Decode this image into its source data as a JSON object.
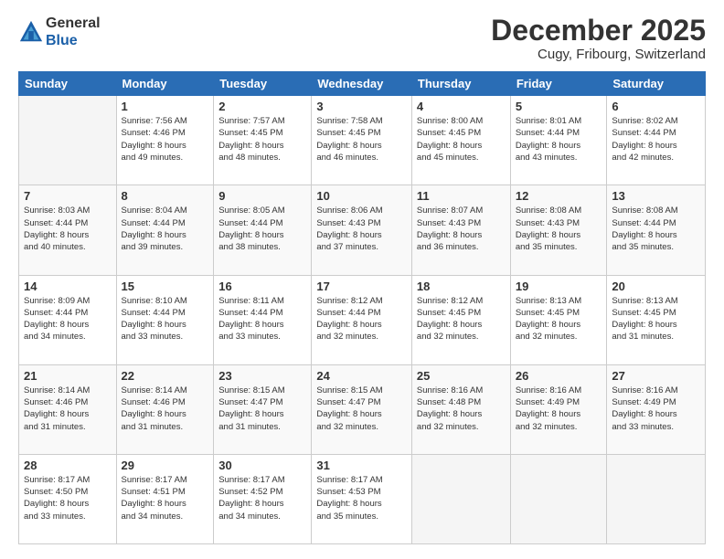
{
  "header": {
    "logo_line1": "General",
    "logo_line2": "Blue",
    "month": "December 2025",
    "location": "Cugy, Fribourg, Switzerland"
  },
  "weekdays": [
    "Sunday",
    "Monday",
    "Tuesday",
    "Wednesday",
    "Thursday",
    "Friday",
    "Saturday"
  ],
  "weeks": [
    [
      {
        "day": "",
        "info": ""
      },
      {
        "day": "1",
        "info": "Sunrise: 7:56 AM\nSunset: 4:46 PM\nDaylight: 8 hours\nand 49 minutes."
      },
      {
        "day": "2",
        "info": "Sunrise: 7:57 AM\nSunset: 4:45 PM\nDaylight: 8 hours\nand 48 minutes."
      },
      {
        "day": "3",
        "info": "Sunrise: 7:58 AM\nSunset: 4:45 PM\nDaylight: 8 hours\nand 46 minutes."
      },
      {
        "day": "4",
        "info": "Sunrise: 8:00 AM\nSunset: 4:45 PM\nDaylight: 8 hours\nand 45 minutes."
      },
      {
        "day": "5",
        "info": "Sunrise: 8:01 AM\nSunset: 4:44 PM\nDaylight: 8 hours\nand 43 minutes."
      },
      {
        "day": "6",
        "info": "Sunrise: 8:02 AM\nSunset: 4:44 PM\nDaylight: 8 hours\nand 42 minutes."
      }
    ],
    [
      {
        "day": "7",
        "info": "Sunrise: 8:03 AM\nSunset: 4:44 PM\nDaylight: 8 hours\nand 40 minutes."
      },
      {
        "day": "8",
        "info": "Sunrise: 8:04 AM\nSunset: 4:44 PM\nDaylight: 8 hours\nand 39 minutes."
      },
      {
        "day": "9",
        "info": "Sunrise: 8:05 AM\nSunset: 4:44 PM\nDaylight: 8 hours\nand 38 minutes."
      },
      {
        "day": "10",
        "info": "Sunrise: 8:06 AM\nSunset: 4:43 PM\nDaylight: 8 hours\nand 37 minutes."
      },
      {
        "day": "11",
        "info": "Sunrise: 8:07 AM\nSunset: 4:43 PM\nDaylight: 8 hours\nand 36 minutes."
      },
      {
        "day": "12",
        "info": "Sunrise: 8:08 AM\nSunset: 4:43 PM\nDaylight: 8 hours\nand 35 minutes."
      },
      {
        "day": "13",
        "info": "Sunrise: 8:08 AM\nSunset: 4:44 PM\nDaylight: 8 hours\nand 35 minutes."
      }
    ],
    [
      {
        "day": "14",
        "info": "Sunrise: 8:09 AM\nSunset: 4:44 PM\nDaylight: 8 hours\nand 34 minutes."
      },
      {
        "day": "15",
        "info": "Sunrise: 8:10 AM\nSunset: 4:44 PM\nDaylight: 8 hours\nand 33 minutes."
      },
      {
        "day": "16",
        "info": "Sunrise: 8:11 AM\nSunset: 4:44 PM\nDaylight: 8 hours\nand 33 minutes."
      },
      {
        "day": "17",
        "info": "Sunrise: 8:12 AM\nSunset: 4:44 PM\nDaylight: 8 hours\nand 32 minutes."
      },
      {
        "day": "18",
        "info": "Sunrise: 8:12 AM\nSunset: 4:45 PM\nDaylight: 8 hours\nand 32 minutes."
      },
      {
        "day": "19",
        "info": "Sunrise: 8:13 AM\nSunset: 4:45 PM\nDaylight: 8 hours\nand 32 minutes."
      },
      {
        "day": "20",
        "info": "Sunrise: 8:13 AM\nSunset: 4:45 PM\nDaylight: 8 hours\nand 31 minutes."
      }
    ],
    [
      {
        "day": "21",
        "info": "Sunrise: 8:14 AM\nSunset: 4:46 PM\nDaylight: 8 hours\nand 31 minutes."
      },
      {
        "day": "22",
        "info": "Sunrise: 8:14 AM\nSunset: 4:46 PM\nDaylight: 8 hours\nand 31 minutes."
      },
      {
        "day": "23",
        "info": "Sunrise: 8:15 AM\nSunset: 4:47 PM\nDaylight: 8 hours\nand 31 minutes."
      },
      {
        "day": "24",
        "info": "Sunrise: 8:15 AM\nSunset: 4:47 PM\nDaylight: 8 hours\nand 32 minutes."
      },
      {
        "day": "25",
        "info": "Sunrise: 8:16 AM\nSunset: 4:48 PM\nDaylight: 8 hours\nand 32 minutes."
      },
      {
        "day": "26",
        "info": "Sunrise: 8:16 AM\nSunset: 4:49 PM\nDaylight: 8 hours\nand 32 minutes."
      },
      {
        "day": "27",
        "info": "Sunrise: 8:16 AM\nSunset: 4:49 PM\nDaylight: 8 hours\nand 33 minutes."
      }
    ],
    [
      {
        "day": "28",
        "info": "Sunrise: 8:17 AM\nSunset: 4:50 PM\nDaylight: 8 hours\nand 33 minutes."
      },
      {
        "day": "29",
        "info": "Sunrise: 8:17 AM\nSunset: 4:51 PM\nDaylight: 8 hours\nand 34 minutes."
      },
      {
        "day": "30",
        "info": "Sunrise: 8:17 AM\nSunset: 4:52 PM\nDaylight: 8 hours\nand 34 minutes."
      },
      {
        "day": "31",
        "info": "Sunrise: 8:17 AM\nSunset: 4:53 PM\nDaylight: 8 hours\nand 35 minutes."
      },
      {
        "day": "",
        "info": ""
      },
      {
        "day": "",
        "info": ""
      },
      {
        "day": "",
        "info": ""
      }
    ]
  ]
}
